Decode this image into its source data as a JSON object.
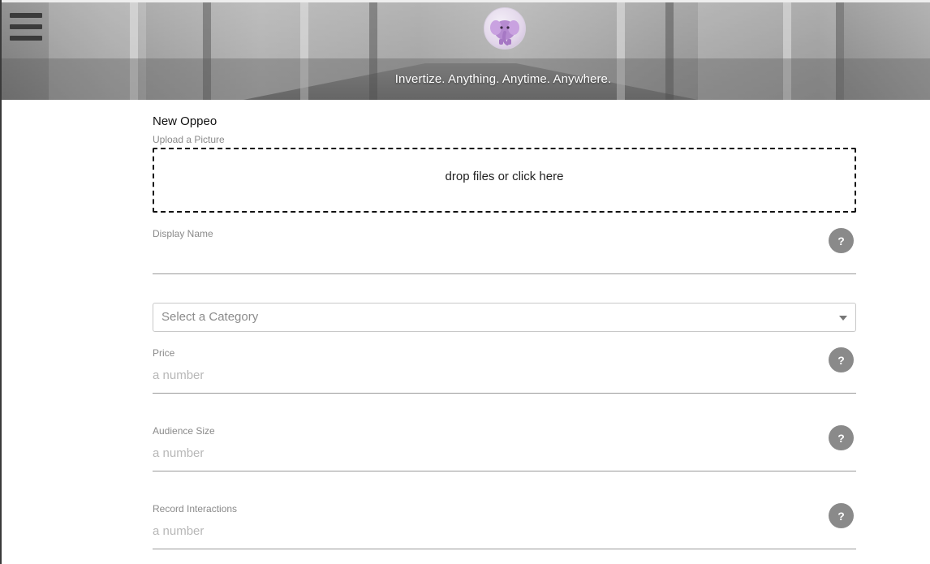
{
  "header": {
    "tagline": "Invertize. Anything. Anytime. Anywhere.",
    "menu_icon": "hamburger-menu-icon",
    "logo_icon": "elephant-logo-icon"
  },
  "form": {
    "title": "New Oppeo",
    "upload_label": "Upload a Picture",
    "dropzone_text": "drop files or click here",
    "display_name": {
      "label": "Display Name",
      "value": ""
    },
    "category": {
      "placeholder": "Select a Category"
    },
    "price": {
      "label": "Price",
      "placeholder": "a number"
    },
    "audience_size": {
      "label": "Audience Size",
      "placeholder": "a number"
    },
    "record_interactions": {
      "label": "Record Interactions",
      "placeholder": "a number"
    },
    "help_symbol": "?"
  },
  "colors": {
    "help_button": "#8a8a8a",
    "line": "#9a9a9a",
    "placeholder": "#b7b7b7"
  }
}
